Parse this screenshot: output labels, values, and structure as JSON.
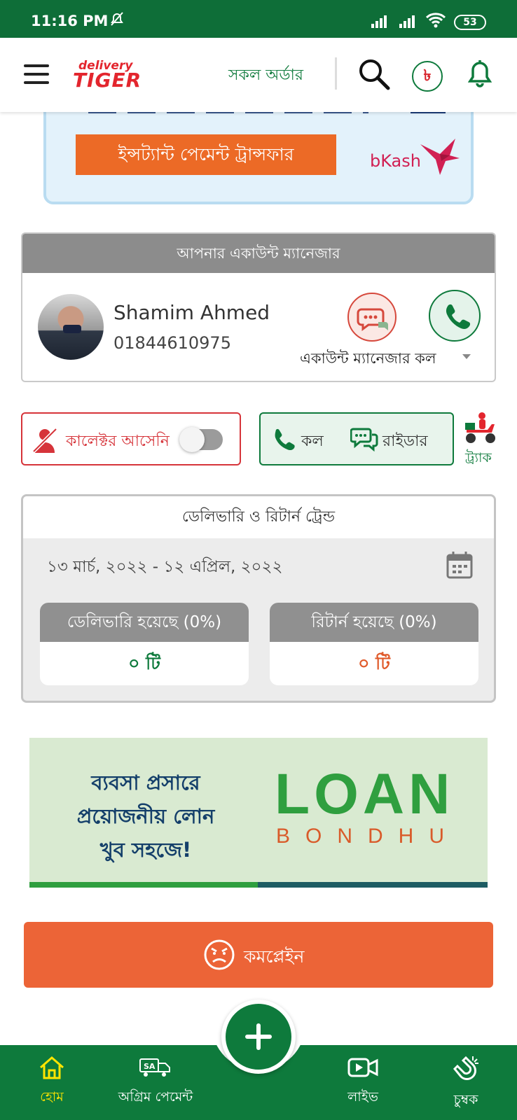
{
  "status_bar": {
    "time": "11:16 PM",
    "battery": "53",
    "icons": [
      "mute-icon",
      "signal-icon",
      "signal-icon",
      "wifi-icon",
      "battery-icon"
    ]
  },
  "header": {
    "logo_small": "delivery",
    "logo_big": "TIGER",
    "all_orders": "সকল অর্ডার",
    "taka_symbol": "৳",
    "icons": [
      "menu-icon",
      "search-icon",
      "taka-icon",
      "bell-icon"
    ]
  },
  "promo_banner": {
    "cta": "ইন্সট্যান্ট পেমেন্ট ট্রান্সফার",
    "brand": "bKash"
  },
  "account_manager": {
    "title": "আপনার একাউন্ট ম্যানেজার",
    "name": "Shamim Ahmed",
    "phone": "01844610975",
    "caption": "একাউন্ট ম্যানেজার কল"
  },
  "collector": {
    "label": "কালেক্টর আসেনি",
    "toggle_on": false
  },
  "rider": {
    "call_label": "কল",
    "rider_label": "রাইডার",
    "track_label": "ট্র্যাক"
  },
  "trend": {
    "title": "ডেলিভারি ও রিটার্ন ট্রেন্ড",
    "date_range": "১৩ মার্চ, ২০২২ - ১২ এপ্রিল, ২০২২",
    "delivered_label": "ডেলিভারি হয়েছে (0%)",
    "delivered_value": "০ টি",
    "returned_label": "রিটার্ন হয়েছে (0%)",
    "returned_value": "০ টি"
  },
  "loan_banner": {
    "line1": "ব্যবসা প্রসারে",
    "line2": "প্রয়োজনীয় লোন",
    "line3": "খুব সহজে!",
    "brand_main": "LOAN",
    "brand_sub": "BONDHU"
  },
  "complain": {
    "label": "কমপ্লেইন"
  },
  "bottom_nav": {
    "items": [
      {
        "label": "হোম",
        "icon": "home-icon",
        "active": true
      },
      {
        "label": "অগ্রিম পেমেন্ট",
        "icon": "advance-payment-icon",
        "active": false
      },
      {
        "label": "লাইভ",
        "icon": "video-icon",
        "active": false
      },
      {
        "label": "চুম্বক",
        "icon": "magnet-icon",
        "active": false
      }
    ],
    "fab_icon": "plus-icon"
  },
  "colors": {
    "primary_green": "#0e7a3c",
    "accent_orange": "#ec6437",
    "danger_red": "#d6343a",
    "header_gray": "#8c8c8c"
  }
}
